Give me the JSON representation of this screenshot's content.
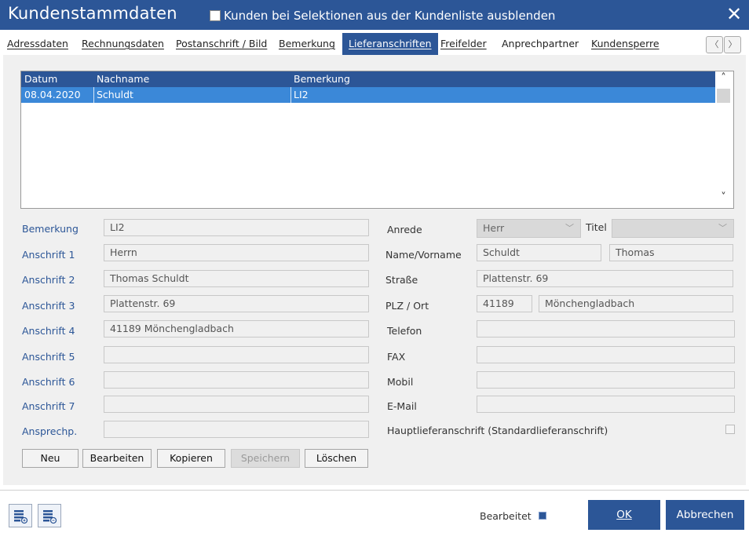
{
  "window": {
    "title": "Kundenstammdaten",
    "hide_checkbox_label": "Kunden bei Selektionen aus der Kundenliste ausblenden",
    "close_label": "✕"
  },
  "tabs": [
    {
      "label": "Adressdaten",
      "active": false
    },
    {
      "label": "Rechnungsdaten",
      "active": false
    },
    {
      "label": "Postanschrift / Bild",
      "active": false
    },
    {
      "label": "Bemerkung",
      "active": false
    },
    {
      "label": "Lieferanschriften",
      "active": true
    },
    {
      "label": "Freifelder",
      "active": false
    },
    {
      "label": "Anprechpartner",
      "active": false
    },
    {
      "label": "Kundensperre",
      "active": false
    }
  ],
  "nav": {
    "prev": "〈",
    "next": "〉"
  },
  "grid": {
    "columns": [
      "Datum",
      "Nachname",
      "Bemerkung"
    ],
    "rows": [
      {
        "datum": "08.04.2020",
        "nachname": "Schuldt",
        "bemerkung": "LI2"
      }
    ],
    "scroll_up": "˄",
    "scroll_down": "˅"
  },
  "left_form": {
    "bemerkung": {
      "label": "Bemerkung",
      "value": "LI2"
    },
    "anschrift1": {
      "label": "Anschrift 1",
      "value": "Herrn"
    },
    "anschrift2": {
      "label": "Anschrift 2",
      "value": "Thomas Schuldt"
    },
    "anschrift3": {
      "label": "Anschrift 3",
      "value": "Plattenstr. 69"
    },
    "anschrift4": {
      "label": "Anschrift 4",
      "value": "41189 Mönchengladbach"
    },
    "anschrift5": {
      "label": "Anschrift 5",
      "value": ""
    },
    "anschrift6": {
      "label": "Anschrift 6",
      "value": ""
    },
    "anschrift7": {
      "label": "Anschrift 7",
      "value": ""
    },
    "ansprechp": {
      "label": "Ansprechp.",
      "value": ""
    }
  },
  "right_form": {
    "anrede": {
      "label": "Anrede",
      "value": "Herr"
    },
    "titel": {
      "label": "Titel",
      "value": ""
    },
    "name": {
      "label": "Name/Vorname",
      "nachname": "Schuldt",
      "vorname": "Thomas"
    },
    "strasse": {
      "label": "Straße",
      "value": "Plattenstr. 69"
    },
    "plz_ort": {
      "label": "PLZ / Ort",
      "plz": "41189",
      "ort": "Mönchengladbach"
    },
    "telefon": {
      "label": "Telefon",
      "value": ""
    },
    "fax": {
      "label": "FAX",
      "value": ""
    },
    "mobil": {
      "label": "Mobil",
      "value": ""
    },
    "email": {
      "label": "E-Mail",
      "value": ""
    },
    "hauptliefer": {
      "label": "Hauptlieferanschrift (Standardlieferanschrift)",
      "checked": false
    }
  },
  "actions": {
    "neu": "Neu",
    "bearbeiten": "Bearbeiten",
    "kopieren": "Kopieren",
    "speichern": "Speichern",
    "loeschen": "Löschen"
  },
  "footer": {
    "bearbeitet_label": "Bearbeitet",
    "ok": "OK",
    "abbrechen": "Abbrechen"
  },
  "colors": {
    "primary": "#2c5697",
    "selected_row": "#3b88d8",
    "panel_bg": "#f0f0f0"
  }
}
